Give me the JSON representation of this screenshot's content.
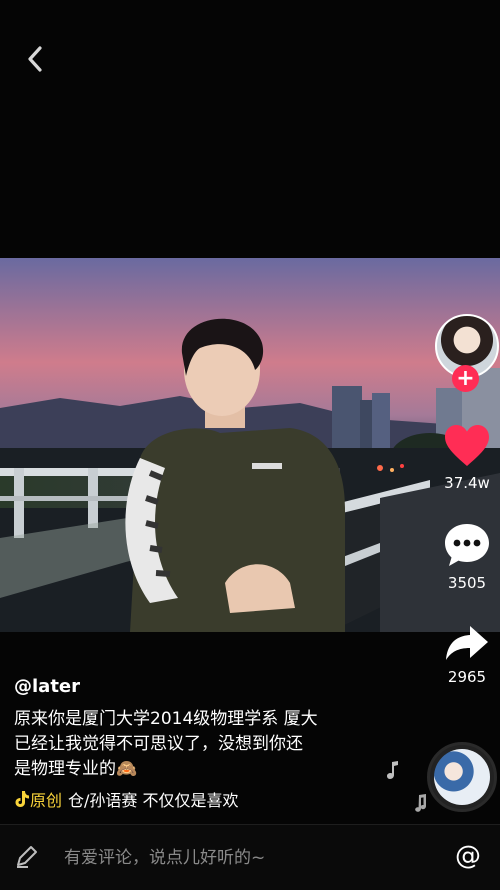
{
  "nav": {
    "back_icon": "chevron-left-icon"
  },
  "video": {
    "description": ""
  },
  "author": {
    "username": "@later",
    "avatar_icon": "avatar",
    "follow_label": "+"
  },
  "actions": {
    "like_count": "37.4w",
    "comment_count": "3505",
    "share_count": "2965",
    "like_color": "#ff2d55"
  },
  "caption": {
    "line1": "原来你是厦门大学2014级物理学系 厦大",
    "line2": "已经让我觉得不可思议了，没想到你还",
    "line3": "是物理专业的🙈"
  },
  "music": {
    "original_label": "原创",
    "track": "仓/孙语赛    不仅仅是喜欢",
    "accent_color": "#fad43a"
  },
  "comment_bar": {
    "placeholder": "有爱评论，说点儿好听的~",
    "at_label": "@"
  }
}
